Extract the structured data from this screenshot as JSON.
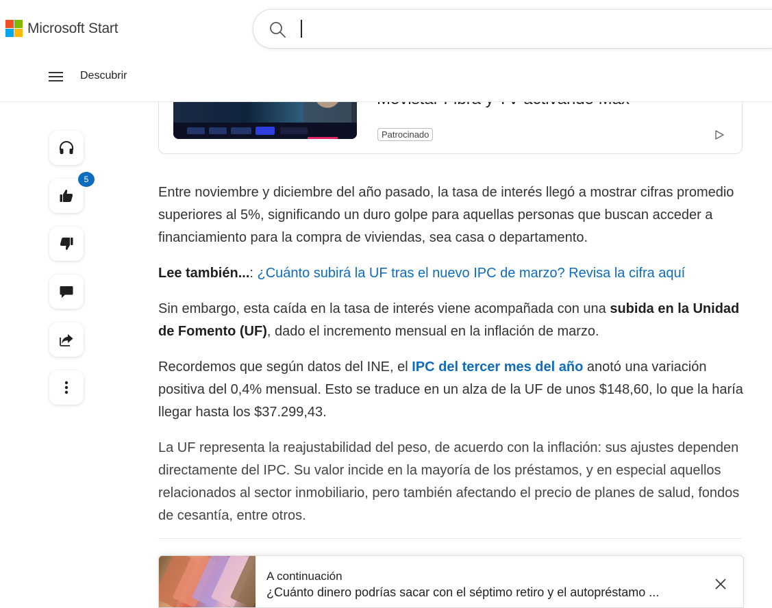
{
  "header": {
    "logo_text": "Microsoft Start",
    "search_placeholder": "",
    "nav_label": "Descubrir",
    "logo_colors": [
      "#f25022",
      "#7fba00",
      "#00a4ef",
      "#ffb900"
    ]
  },
  "rail": {
    "like_count": "5",
    "accent": "#0f6cbd",
    "icons": [
      "headphones-icon",
      "thumbs-up-icon",
      "thumbs-down-icon",
      "comment-icon",
      "share-icon",
      "more-icon"
    ]
  },
  "ad": {
    "title": "Movistar Fibra y TV activando Max",
    "tag": "Patrocinado"
  },
  "article": {
    "p1": "Entre noviembre y diciembre del año pasado, la tasa de interés llegó a mostrar cifras promedio superiores al 5%, significando un duro golpe para aquellas personas que buscan acceder a financiamiento para la compra de viviendas, sea casa o departamento.",
    "read_also_label": "Lee también...",
    "read_also_sep": ": ",
    "read_also_link": "¿Cuánto subirá la UF tras el nuevo IPC de marzo? Revisa la cifra aquí",
    "p3_a": "Sin embargo, esta caída en la tasa de interés viene acompañada con una ",
    "p3_bold": "subida en la Unidad de Fomento (UF)",
    "p3_b": ", dado el incremento mensual en la inflación de marzo.",
    "p4_a": "Recordemos que según datos del INE, el ",
    "p4_link": "IPC del tercer mes del año",
    "p4_b": " anotó una variación positiva del 0,4% mensual. Esto se traduce en un alza de la UF de unos $148,60, lo que la haría llegar hasta los $37.299,43.",
    "p5": "La UF representa la reajustabilidad del peso, de acuerdo con la inflación: sus ajustes dependen directamente del IPC. Su valor incide en la mayoría de los préstamos, y en especial aquellos relacionados al sector inmobiliario, pero también afectando el precio de planes de salud, fondos de cesantía, entre otros.",
    "link_color": "#0f6cbd"
  },
  "up_next": {
    "label": "A continuación",
    "title": "¿Cuánto dinero podrías sacar con el séptimo retiro y el autopréstamo ..."
  }
}
